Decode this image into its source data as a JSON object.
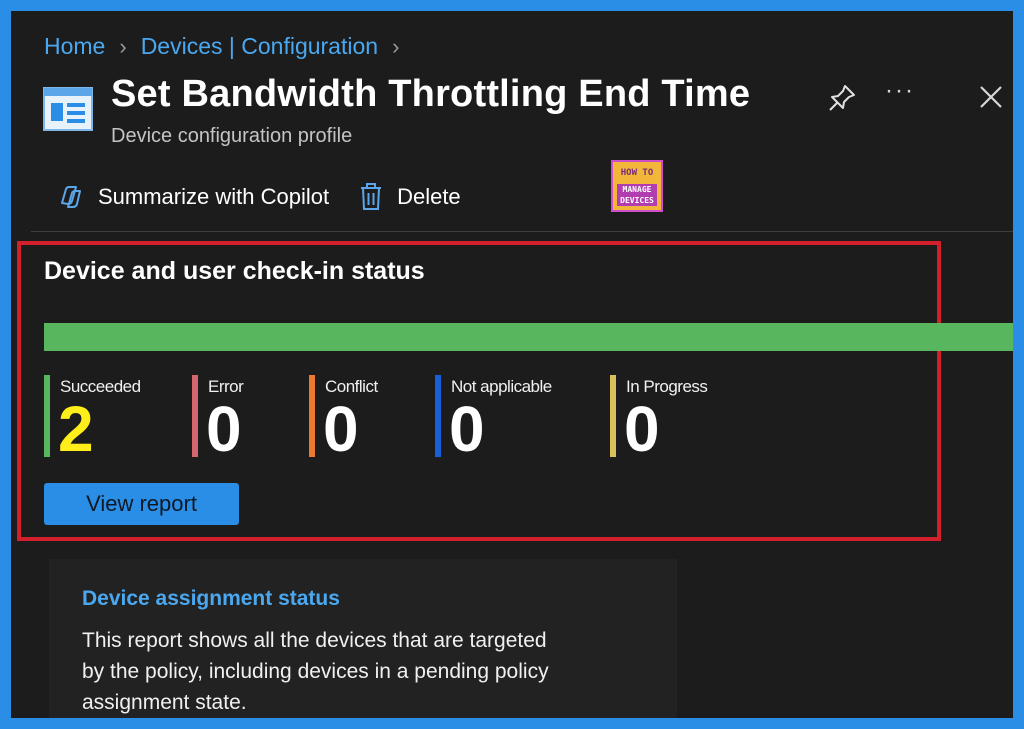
{
  "breadcrumb": {
    "items": [
      "Home",
      "Devices | Configuration"
    ]
  },
  "header": {
    "title": "Set Bandwidth Throttling End Time",
    "subtitle": "Device configuration profile",
    "more_label": "···"
  },
  "toolbar": {
    "copilot_label": "Summarize with Copilot",
    "delete_label": "Delete"
  },
  "logo": {
    "line1": "HOW TO",
    "line2a": "MANAGE",
    "line2b": "DEVICES"
  },
  "checkin": {
    "title": "Device and user check-in status",
    "progress_fraction": 1.0,
    "statuses": [
      {
        "label": "Succeeded",
        "value": "2",
        "color": "#58b65e"
      },
      {
        "label": "Error",
        "value": "0",
        "color": "#d3666e"
      },
      {
        "label": "Conflict",
        "value": "0",
        "color": "#ec7a2c"
      },
      {
        "label": "Not applicable",
        "value": "0",
        "color": "#1b5fd6"
      },
      {
        "label": "In Progress",
        "value": "0",
        "color": "#d8c05a"
      }
    ],
    "view_report_label": "View report"
  },
  "assignment_card": {
    "title": "Device assignment status",
    "description": "This report shows all the devices that are targeted by the policy, including devices in a pending policy assignment state."
  },
  "colors": {
    "accent": "#2b8ee6",
    "highlight": "#d4202a",
    "success": "#58b65e"
  }
}
